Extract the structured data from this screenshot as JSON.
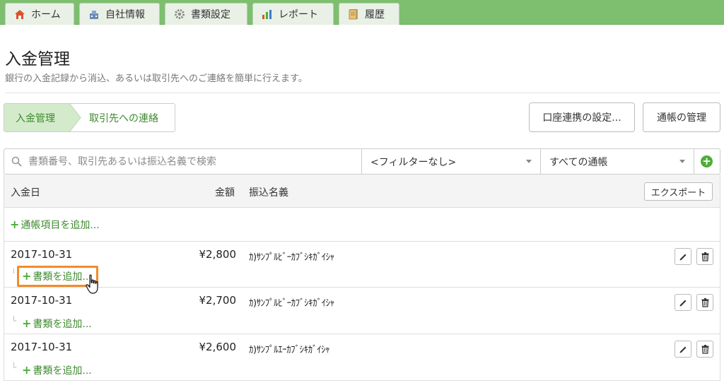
{
  "nav": {
    "tabs": [
      {
        "label": "ホーム",
        "icon": "home-icon"
      },
      {
        "label": "自社情報",
        "icon": "company-icon"
      },
      {
        "label": "書類設定",
        "icon": "gear-icon"
      },
      {
        "label": "レポート",
        "icon": "chart-icon"
      },
      {
        "label": "履歴",
        "icon": "history-icon"
      }
    ]
  },
  "page": {
    "title": "入金管理",
    "subtitle": "銀行の入金記録から消込、あるいは取引先へのご連絡を簡単に行えます。"
  },
  "steps": {
    "items": [
      "入金管理",
      "取引先への連絡"
    ],
    "active_index": 0
  },
  "actions": {
    "account_link_label": "口座連携の設定...",
    "passbook_label": "通帳の管理"
  },
  "filters": {
    "search_placeholder": "書類番号、取引先あるいは振込名義で検索",
    "filter_value": "<フィルターなし>",
    "passbook_value": "すべての通帳"
  },
  "table": {
    "columns": {
      "date": "入金日",
      "amount": "金額",
      "payer": "振込名義"
    },
    "export_label": "エクスポート",
    "add_entry_label": "通帳項目を追加...",
    "rows": [
      {
        "date": "2017-10-31",
        "amount": "¥2,800",
        "payer": "ｶ)ｻﾝﾌﾟﾙﾋﾞｰｶﾌﾞｼｷｶﾞｲｼｬ",
        "add_doc_label": "書類を追加..."
      },
      {
        "date": "2017-10-31",
        "amount": "¥2,700",
        "payer": "ｶ)ｻﾝﾌﾟﾙﾋﾞｰｶﾌﾞｼｷｶﾞｲｼｬ",
        "add_doc_label": "書類を追加..."
      },
      {
        "date": "2017-10-31",
        "amount": "¥2,600",
        "payer": "ｶ)ｻﾝﾌﾟﾙｴｰｶﾌﾞｼｷｶﾞｲｼｬ",
        "add_doc_label": "書類を追加..."
      }
    ]
  },
  "colors": {
    "topbar": "#7dbf6e",
    "accent_green": "#4cae36",
    "link_green": "#3e8a2f",
    "highlight_orange": "#f28c28"
  }
}
